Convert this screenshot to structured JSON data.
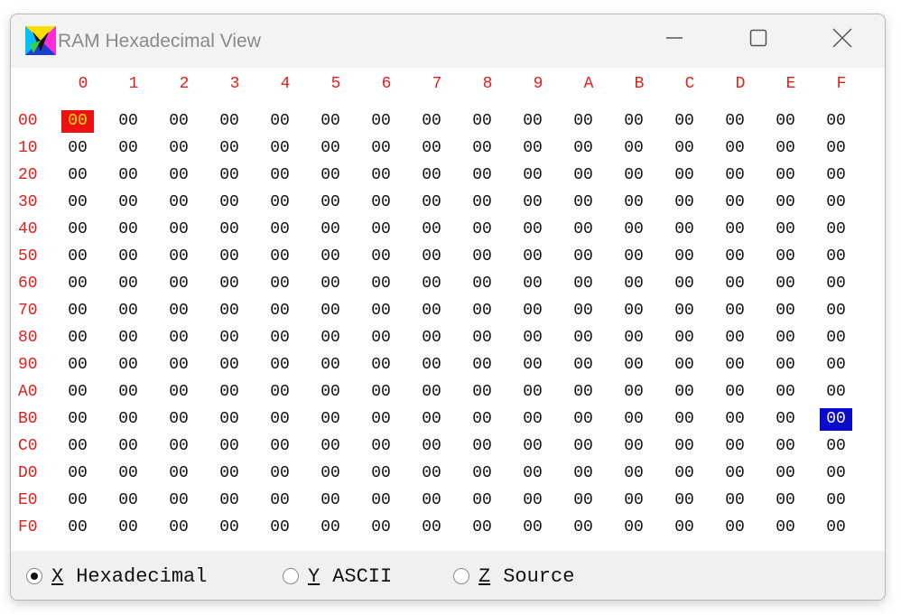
{
  "window": {
    "title": "RAM Hexadecimal View",
    "icon": "app-logo-icon",
    "controls": [
      "minimize-icon",
      "maximize-icon",
      "close-icon"
    ]
  },
  "hex_grid": {
    "column_headers": [
      "0",
      "1",
      "2",
      "3",
      "4",
      "5",
      "6",
      "7",
      "8",
      "9",
      "A",
      "B",
      "C",
      "D",
      "E",
      "F"
    ],
    "row_headers": [
      "00",
      "10",
      "20",
      "30",
      "40",
      "50",
      "60",
      "70",
      "80",
      "90",
      "A0",
      "B0",
      "C0",
      "D0",
      "E0",
      "F0"
    ],
    "cell_value": "00",
    "selected_cells": [
      {
        "row": 0,
        "col": 0,
        "style": "red"
      },
      {
        "row": 11,
        "col": 15,
        "style": "blue"
      }
    ],
    "colors": {
      "header": "#e0201c",
      "cursor_red": "#ee1111",
      "cursor_red_text": "#ffe000",
      "cursor_blue": "#0a0acc"
    }
  },
  "view_mode": {
    "options": [
      {
        "hotkey": "X",
        "label": "Hexadecimal",
        "checked": true
      },
      {
        "hotkey": "Y",
        "label": "ASCII",
        "checked": false
      },
      {
        "hotkey": "Z",
        "label": "Source",
        "checked": false
      }
    ]
  }
}
